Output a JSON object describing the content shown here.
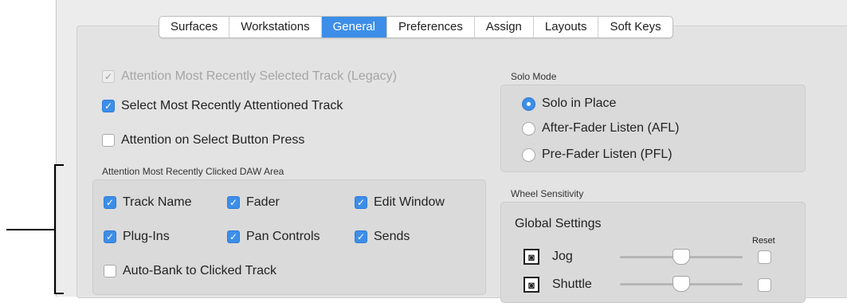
{
  "tabs": [
    {
      "label": "Surfaces",
      "active": false
    },
    {
      "label": "Workstations",
      "active": false
    },
    {
      "label": "General",
      "active": true
    },
    {
      "label": "Preferences",
      "active": false
    },
    {
      "label": "Assign",
      "active": false
    },
    {
      "label": "Layouts",
      "active": false
    },
    {
      "label": "Soft Keys",
      "active": false
    }
  ],
  "attention": {
    "legacy": {
      "label": "Attention Most Recently Selected Track (Legacy)",
      "checked": true,
      "disabled": true
    },
    "select_recent": {
      "label": "Select Most Recently Attentioned Track",
      "checked": true
    },
    "select_button": {
      "label": "Attention on Select Button Press",
      "checked": false
    }
  },
  "daw_area": {
    "label": "Attention Most Recently Clicked DAW Area",
    "track_name": {
      "label": "Track Name",
      "checked": true
    },
    "fader": {
      "label": "Fader",
      "checked": true
    },
    "edit_window": {
      "label": "Edit Window",
      "checked": true
    },
    "plug_ins": {
      "label": "Plug-Ins",
      "checked": true
    },
    "pan_controls": {
      "label": "Pan Controls",
      "checked": true
    },
    "sends": {
      "label": "Sends",
      "checked": true
    },
    "auto_bank": {
      "label": "Auto-Bank to Clicked Track",
      "checked": false
    }
  },
  "solo_mode": {
    "label": "Solo Mode",
    "options": [
      {
        "label": "Solo in Place",
        "selected": true
      },
      {
        "label": "After-Fader Listen (AFL)",
        "selected": false
      },
      {
        "label": "Pre-Fader Listen (PFL)",
        "selected": false
      }
    ]
  },
  "wheel": {
    "label": "Wheel Sensitivity",
    "global_label": "Global Settings",
    "reset_label": "Reset",
    "jog": {
      "label": "Jog",
      "level": 0.5
    },
    "shuttle": {
      "label": "Shuttle",
      "level": 0.5
    }
  },
  "colors": {
    "accent": "#3d8ee8",
    "panel": "#e3e3e3",
    "group_box": "#dadada"
  }
}
